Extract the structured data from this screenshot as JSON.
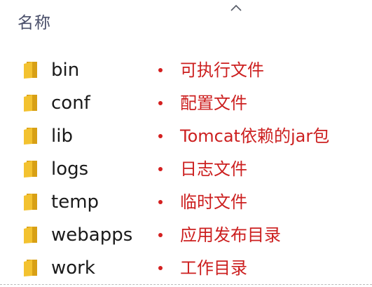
{
  "header": {
    "column_name": "名称",
    "sort_icon": "chevron-up-icon"
  },
  "colors": {
    "folder": "#f3c230",
    "folder_back": "#d8a015",
    "annotation": "#cc1f1f",
    "header_text": "#4a4f6a"
  },
  "folders": [
    {
      "name": "bin",
      "icon": "folder-icon",
      "description": "可执行文件"
    },
    {
      "name": "conf",
      "icon": "folder-icon",
      "description": "配置文件"
    },
    {
      "name": "lib",
      "icon": "folder-icon",
      "description": "Tomcat依赖的jar包"
    },
    {
      "name": "logs",
      "icon": "folder-icon",
      "description": "日志文件"
    },
    {
      "name": "temp",
      "icon": "folder-icon",
      "description": "临时文件"
    },
    {
      "name": "webapps",
      "icon": "folder-icon",
      "description": "应用发布目录"
    },
    {
      "name": "work",
      "icon": "folder-icon",
      "description": "工作目录"
    }
  ]
}
